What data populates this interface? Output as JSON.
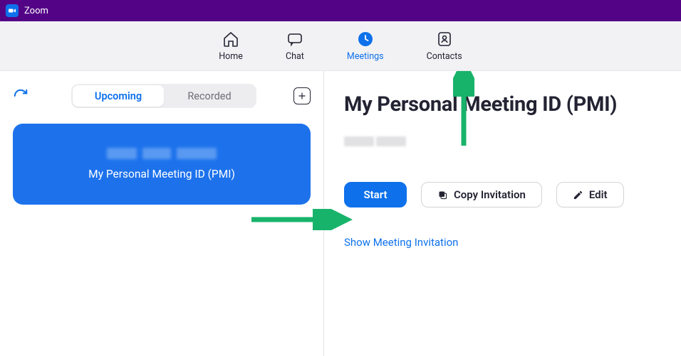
{
  "titlebar": {
    "app_name": "Zoom"
  },
  "nav": {
    "home": "Home",
    "chat": "Chat",
    "meetings": "Meetings",
    "contacts": "Contacts"
  },
  "left": {
    "upcoming": "Upcoming",
    "recorded": "Recorded",
    "card_label": "My Personal Meeting ID (PMI)"
  },
  "right": {
    "title": "My Personal Meeting ID (PMI)",
    "start": "Start",
    "copy": "Copy Invitation",
    "edit": "Edit",
    "show_invitation": "Show Meeting Invitation"
  }
}
